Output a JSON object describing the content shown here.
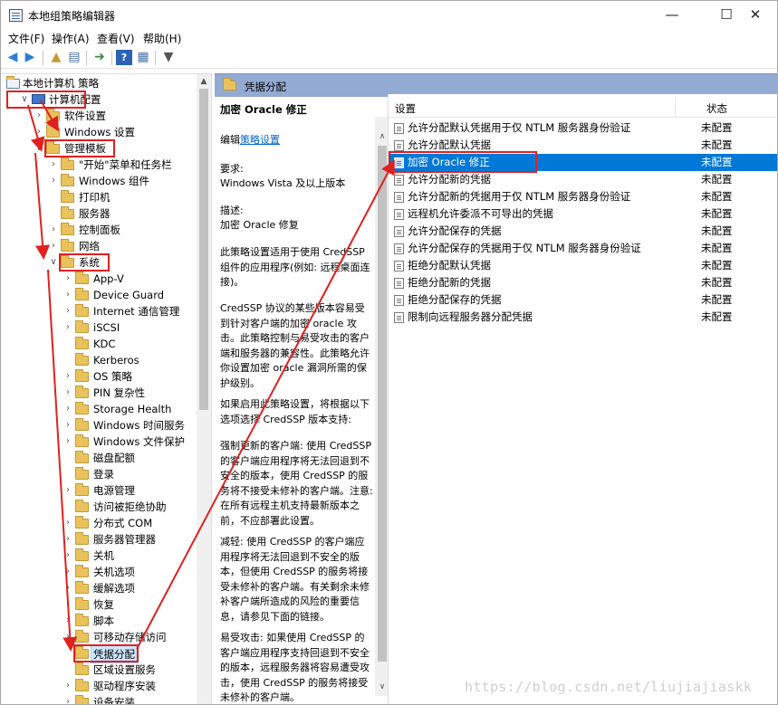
{
  "window": {
    "title": "本地组策略编辑器",
    "min": "—",
    "max": "☐",
    "close": "✕"
  },
  "menu": [
    "文件(F)",
    "操作(A)",
    "查看(V)",
    "帮助(H)"
  ],
  "toolbar": {
    "icons": [
      "back-icon",
      "forward-icon",
      "up-folder-icon",
      "show-hide-tree-icon",
      "export-list-icon",
      "help-icon",
      "properties-icon",
      "filter-icon"
    ]
  },
  "tree": {
    "root": "本地计算机 策略",
    "computer_config": "计算机配置",
    "software_settings": "软件设置",
    "windows_settings": "Windows 设置",
    "admin_templates": "管理模板",
    "start_menu": "\"开始\"菜单和任务栏",
    "windows_components": "Windows 组件",
    "printers": "打印机",
    "server": "服务器",
    "control_panel": "控制面板",
    "network": "网络",
    "system": "系统",
    "system_children": [
      "App-V",
      "Device Guard",
      "Internet 通信管理",
      "iSCSI",
      "KDC",
      "Kerberos",
      "OS 策略",
      "PIN 复杂性",
      "Storage Health",
      "Windows 时间服务",
      "Windows 文件保护",
      "磁盘配额",
      "登录",
      "电源管理",
      "访问被拒绝协助",
      "分布式 COM",
      "服务器管理器",
      "关机",
      "关机选项",
      "缓解选项",
      "恢复",
      "脚本",
      "可移动存储访问",
      "凭据分配",
      "区域设置服务",
      "驱动程序安装",
      "设备安装"
    ]
  },
  "header": {
    "folder_name": "凭据分配"
  },
  "description": {
    "policy_title": "加密 Oracle 修正",
    "edit_prefix": "编辑",
    "edit_link": "策略设置",
    "req_label": "要求:",
    "req_value": "Windows Vista 及以上版本",
    "desc_label": "描述:",
    "desc_value": "加密 Oracle 修复",
    "p1": "此策略设置适用于使用 CredSSP 组件的应用程序(例如: 远程桌面连接)。",
    "p2": "CredSSP 协议的某些版本容易受到针对客户端的加密 oracle 攻击。此策略控制与易受攻击的客户端和服务器的兼容性。此策略允许你设置加密 oracle 漏洞所需的保护级别。",
    "p3": "如果启用此策略设置，将根据以下选项选择 CredSSP 版本支持:",
    "p4": "强制更新的客户端: 使用 CredSSP 的客户端应用程序将无法回退到不安全的版本，使用 CredSSP 的服务将不接受未修补的客户端。注意: 在所有远程主机支持最新版本之前，不应部署此设置。",
    "p5": "减轻: 使用 CredSSP 的客户端应用程序将无法回退到不安全的版本，但使用 CredSSP 的服务将接受未修补的客户端。有关剩余未修补客户端所造成的风险的重要信息，请参见下面的链接。",
    "p6": "易受攻击: 如果使用 CredSSP 的客户端应用程序支持回退到不安全的版本，远程服务器将容易遭受攻击，使用 CredSSP 的服务将接受未修补的客户端。"
  },
  "list": {
    "col_setting": "设置",
    "col_state": "状态",
    "rows": [
      {
        "name": "允许分配默认凭据用于仅 NTLM 服务器身份验证",
        "state": "未配置"
      },
      {
        "name": "允许分配默认凭据",
        "state": "未配置"
      },
      {
        "name": "加密 Oracle 修正",
        "state": "未配置"
      },
      {
        "name": "允许分配新的凭据",
        "state": "未配置"
      },
      {
        "name": "允许分配新的凭据用于仅 NTLM 服务器身份验证",
        "state": "未配置"
      },
      {
        "name": "远程机允许委派不可导出的凭据",
        "state": "未配置"
      },
      {
        "name": "允许分配保存的凭据",
        "state": "未配置"
      },
      {
        "name": "允许分配保存的凭据用于仅 NTLM 服务器身份验证",
        "state": "未配置"
      },
      {
        "name": "拒绝分配默认凭据",
        "state": "未配置"
      },
      {
        "name": "拒绝分配新的凭据",
        "state": "未配置"
      },
      {
        "name": "拒绝分配保存的凭据",
        "state": "未配置"
      },
      {
        "name": "限制向远程服务器分配凭据",
        "state": "未配置"
      }
    ],
    "selected_index": 2
  },
  "watermark": "https://blog.csdn.net/liujiajiaskk",
  "colors": {
    "selection": "#0078d7",
    "header": "#93aad3",
    "annotation": "#e02020"
  }
}
